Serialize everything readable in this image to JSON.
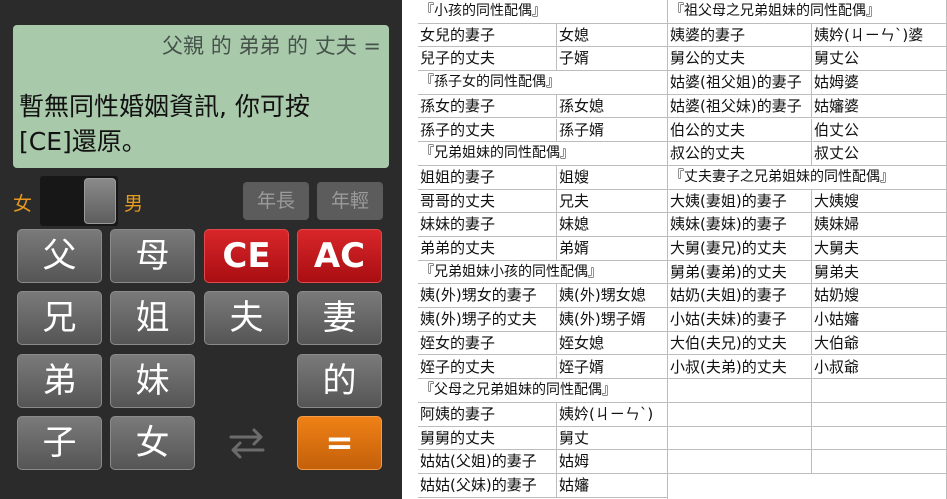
{
  "calculator": {
    "expression": "父親 的 弟弟 的 丈夫 =",
    "message": "暫無同性婚姻資訊, 你可按[CE]還原。",
    "gender_female": "女",
    "gender_male": "男",
    "older_label": "年長",
    "younger_label": "年輕",
    "keys": {
      "father": "父",
      "mother": "母",
      "ce": "CE",
      "ac": "AC",
      "elder_brother": "兄",
      "elder_sister": "姐",
      "husband": "夫",
      "wife": "妻",
      "younger_brother": "弟",
      "younger_sister": "妹",
      "of": "的",
      "son": "子",
      "daughter": "女",
      "equals": "="
    },
    "swap_icon": "swap-arrows-icon",
    "colors": {
      "display": "#a9c9ab",
      "clear": "#c8161b",
      "equals": "#e2730f",
      "gender": "#e69a1e"
    }
  },
  "tables": {
    "left": [
      {
        "type": "header",
        "c1": "『小孩的同性配偶』"
      },
      {
        "c1": "女兒的妻子",
        "c2": "女媳"
      },
      {
        "c1": "兒子的丈夫",
        "c2": "子婿"
      },
      {
        "type": "header",
        "c1": "『孫子女的同性配偶』"
      },
      {
        "c1": "孫女的妻子",
        "c2": "孫女媳"
      },
      {
        "c1": "孫子的丈夫",
        "c2": "孫子婿"
      },
      {
        "type": "header",
        "c1": "『兄弟姐妹的同性配偶』"
      },
      {
        "c1": "姐姐的妻子",
        "c2": "姐嫂"
      },
      {
        "c1": "哥哥的丈夫",
        "c2": "兄夫"
      },
      {
        "c1": "妹妹的妻子",
        "c2": "妹媳"
      },
      {
        "c1": "弟弟的丈夫",
        "c2": "弟婿"
      },
      {
        "type": "header",
        "c1": "『兄弟姐妹小孩的同性配偶』"
      },
      {
        "c1": "姨(外)甥女的妻子",
        "c2": "姨(外)甥女媳"
      },
      {
        "c1": "姨(外)甥子的丈夫",
        "c2": "姨(外)甥子婿"
      },
      {
        "c1": "姪女的妻子",
        "c2": "姪女媳"
      },
      {
        "c1": "姪子的丈夫",
        "c2": "姪子婿"
      },
      {
        "type": "header",
        "c1": "『父母之兄弟姐妹的同性配偶』"
      },
      {
        "c1": "阿姨的妻子",
        "c2": "姨妗(ㄐㄧㄣˋ)"
      },
      {
        "c1": "舅舅的丈夫",
        "c2": "舅丈"
      },
      {
        "c1": "姑姑(父姐)的妻子",
        "c2": "姑姆"
      },
      {
        "c1": "姑姑(父妹)的妻子",
        "c2": "姑嬸"
      }
    ],
    "right": [
      {
        "type": "header",
        "c1": "『祖父母之兄弟姐妹的同性配偶』"
      },
      {
        "c1": "姨婆的妻子",
        "c2": "姨妗(ㄐㄧㄣˋ)婆"
      },
      {
        "c1": "舅公的丈夫",
        "c2": "舅丈公"
      },
      {
        "c1": "姑婆(祖父姐)的妻子",
        "c2": "姑姆婆"
      },
      {
        "c1": "姑婆(祖父妹)的妻子",
        "c2": "姑嬸婆"
      },
      {
        "c1": "伯公的丈夫",
        "c2": "伯丈公"
      },
      {
        "c1": "叔公的丈夫",
        "c2": "叔丈公"
      },
      {
        "type": "header",
        "c1": "『丈夫妻子之兄弟姐妹的同性配偶』"
      },
      {
        "c1": "大姨(妻姐)的妻子",
        "c2": "大姨嫂"
      },
      {
        "c1": "姨妹(妻妹)的妻子",
        "c2": "姨妹婦"
      },
      {
        "c1": "大舅(妻兄)的丈夫",
        "c2": "大舅夫"
      },
      {
        "c1": "舅弟(妻弟)的丈夫",
        "c2": "舅弟夫"
      },
      {
        "c1": "姑奶(夫姐)的妻子",
        "c2": "姑奶嫂"
      },
      {
        "c1": "小姑(夫妹)的妻子",
        "c2": "小姑嬸"
      },
      {
        "c1": "大伯(夫兄)的丈夫",
        "c2": "大伯爺"
      },
      {
        "c1": "小叔(夫弟)的丈夫",
        "c2": "小叔爺"
      },
      {
        "type": "empty"
      },
      {
        "type": "empty"
      },
      {
        "type": "empty"
      },
      {
        "type": "empty"
      }
    ]
  }
}
